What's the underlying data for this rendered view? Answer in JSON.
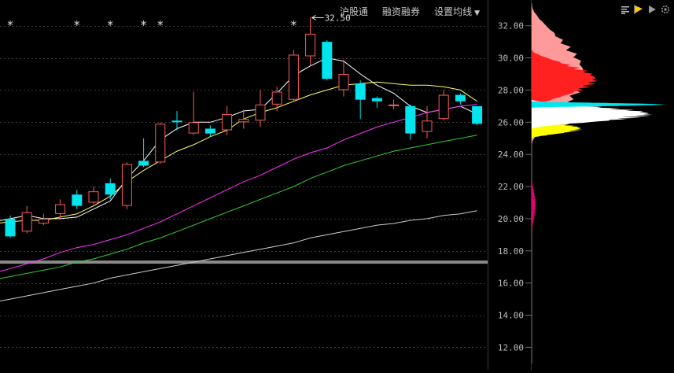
{
  "toolbar": {
    "hk_connect": "沪股通",
    "margin_trading": "融资融券",
    "ma_settings": "设置均线"
  },
  "icons": [
    "bars-icon",
    "flag-icon",
    "play-icon",
    "gear-icon"
  ],
  "colors": {
    "up": "#ff5a5a",
    "down": "#00e5ee",
    "ma5": "#ffffff",
    "ma10": "#ffff66",
    "ma20": "#ff33ff",
    "ma30": "#33cc33",
    "ma60": "#cccccc",
    "profile_red": "#ff2020",
    "profile_pink": "#ff9a9a",
    "profile_yellow": "#ffff00",
    "profile_cyan": "#00e5ee",
    "profile_white": "#ffffff",
    "profile_magenta": "#e0006e"
  },
  "chart_data": {
    "type": "candlestick",
    "ylim": [
      10.6,
      33.6
    ],
    "y_ticks": [
      "32.00",
      "30.00",
      "28.00",
      "26.00",
      "24.00",
      "22.00",
      "20.00",
      "18.00",
      "16.00",
      "14.00",
      "12.00"
    ],
    "high_label": "32.50",
    "cost_line_price": 17.3,
    "candles": [
      {
        "o": 20.0,
        "c": 18.9,
        "h": 20.2,
        "l": 18.8,
        "star": true
      },
      {
        "o": 19.2,
        "c": 20.4,
        "h": 20.8,
        "l": 19.1,
        "star": false
      },
      {
        "o": 19.7,
        "c": 20.0,
        "h": 20.3,
        "l": 19.6,
        "star": false
      },
      {
        "o": 20.3,
        "c": 20.9,
        "h": 21.2,
        "l": 20.0,
        "star": false
      },
      {
        "o": 21.5,
        "c": 20.8,
        "h": 21.8,
        "l": 20.6,
        "star": true
      },
      {
        "o": 21.0,
        "c": 21.7,
        "h": 22.0,
        "l": 20.9,
        "star": false
      },
      {
        "o": 22.2,
        "c": 21.5,
        "h": 22.5,
        "l": 21.2,
        "star": true
      },
      {
        "o": 20.8,
        "c": 23.4,
        "h": 23.5,
        "l": 20.6,
        "star": false
      },
      {
        "o": 23.6,
        "c": 23.3,
        "h": 25.0,
        "l": 23.2,
        "star": true
      },
      {
        "o": 23.5,
        "c": 25.9,
        "h": 26.0,
        "l": 23.4,
        "star": true
      },
      {
        "o": 26.1,
        "c": 26.0,
        "h": 26.7,
        "l": 25.5,
        "star": false
      },
      {
        "o": 25.3,
        "c": 26.0,
        "h": 27.9,
        "l": 25.2,
        "star": false
      },
      {
        "o": 25.6,
        "c": 25.3,
        "h": 25.8,
        "l": 25.1,
        "star": false
      },
      {
        "o": 25.5,
        "c": 26.5,
        "h": 27.0,
        "l": 25.2,
        "star": false
      },
      {
        "o": 26.0,
        "c": 26.2,
        "h": 26.8,
        "l": 25.6,
        "star": false
      },
      {
        "o": 26.1,
        "c": 27.1,
        "h": 28.0,
        "l": 25.7,
        "star": false
      },
      {
        "o": 27.1,
        "c": 27.9,
        "h": 28.2,
        "l": 26.7,
        "star": false
      },
      {
        "o": 27.4,
        "c": 30.2,
        "h": 30.5,
        "l": 27.3,
        "star": true
      },
      {
        "o": 30.1,
        "c": 31.5,
        "h": 32.5,
        "l": 29.5,
        "star": false
      },
      {
        "o": 31.0,
        "c": 28.7,
        "h": 31.1,
        "l": 28.6,
        "star": false
      },
      {
        "o": 28.0,
        "c": 29.0,
        "h": 29.9,
        "l": 27.6,
        "star": false
      },
      {
        "o": 28.4,
        "c": 27.4,
        "h": 28.6,
        "l": 26.2,
        "star": false
      },
      {
        "o": 27.5,
        "c": 27.3,
        "h": 27.6,
        "l": 26.9,
        "star": false
      },
      {
        "o": 27.0,
        "c": 27.1,
        "h": 27.4,
        "l": 26.8,
        "star": false
      },
      {
        "o": 27.0,
        "c": 25.3,
        "h": 27.1,
        "l": 24.9,
        "star": false
      },
      {
        "o": 25.4,
        "c": 26.1,
        "h": 27.0,
        "l": 25.0,
        "star": false
      },
      {
        "o": 26.2,
        "c": 27.7,
        "h": 28.0,
        "l": 26.1,
        "star": false
      },
      {
        "o": 27.7,
        "c": 27.3,
        "h": 27.8,
        "l": 27.1,
        "star": false
      },
      {
        "o": 27.0,
        "c": 25.9,
        "h": 27.0,
        "l": 25.8,
        "star": false
      }
    ],
    "ma": [
      {
        "key": "ma5",
        "values": [
          20.0,
          20.2,
          20.0,
          20.0,
          20.1,
          20.6,
          21.1,
          22.5,
          23.6,
          24.9,
          25.6,
          26.0,
          26.0,
          26.3,
          26.7,
          26.8,
          27.8,
          28.9,
          29.5,
          30.0,
          29.8,
          29.0,
          28.3,
          27.8,
          27.0,
          26.6,
          26.8,
          27.0,
          26.5
        ]
      },
      {
        "key": "ma10",
        "values": [
          19.8,
          19.9,
          19.9,
          20.1,
          20.3,
          20.8,
          21.4,
          22.3,
          23.0,
          23.6,
          24.2,
          24.6,
          25.1,
          25.5,
          26.2,
          26.6,
          26.9,
          27.3,
          27.7,
          28.0,
          28.3,
          28.4,
          28.5,
          28.4,
          28.3,
          28.3,
          28.2,
          28.0,
          27.3
        ]
      },
      {
        "key": "ma20",
        "values": [
          16.9,
          17.2,
          17.5,
          17.9,
          18.2,
          18.4,
          18.7,
          19.0,
          19.4,
          19.8,
          20.3,
          20.8,
          21.3,
          21.8,
          22.3,
          22.7,
          23.2,
          23.7,
          24.1,
          24.4,
          24.9,
          25.3,
          25.7,
          26.0,
          26.3,
          26.6,
          26.8,
          27.0,
          27.1
        ]
      },
      {
        "key": "ma30",
        "values": [
          16.4,
          16.6,
          16.8,
          17.0,
          17.3,
          17.5,
          17.8,
          18.1,
          18.5,
          18.8,
          19.2,
          19.6,
          20.0,
          20.4,
          20.8,
          21.2,
          21.6,
          22.0,
          22.5,
          22.9,
          23.3,
          23.6,
          23.9,
          24.2,
          24.4,
          24.6,
          24.8,
          25.0,
          25.2
        ]
      },
      {
        "key": "ma60",
        "values": [
          15.0,
          15.2,
          15.4,
          15.6,
          15.8,
          16.0,
          16.3,
          16.5,
          16.7,
          16.9,
          17.1,
          17.3,
          17.5,
          17.7,
          17.9,
          18.1,
          18.3,
          18.5,
          18.8,
          19.0,
          19.2,
          19.4,
          19.6,
          19.7,
          19.9,
          20.0,
          20.2,
          20.3,
          20.5
        ]
      }
    ],
    "volume_profile": {
      "segments": [
        {
          "color_key": "profile_magenta",
          "from": 19.1,
          "to": 22.6,
          "peak": 5
        },
        {
          "color_key": "profile_pink",
          "from": 24.6,
          "to": 33.3,
          "peak": 70
        },
        {
          "color_key": "profile_red",
          "from": 26.8,
          "to": 30.5,
          "peak": 86
        },
        {
          "color_key": "profile_yellow",
          "from": 25.0,
          "to": 26.2,
          "peak": 66
        },
        {
          "color_key": "profile_white",
          "from": 25.6,
          "to": 27.4,
          "peak": 158
        },
        {
          "color_key": "profile_cyan",
          "from": 26.9,
          "to": 27.3,
          "peak": 178
        }
      ]
    }
  }
}
